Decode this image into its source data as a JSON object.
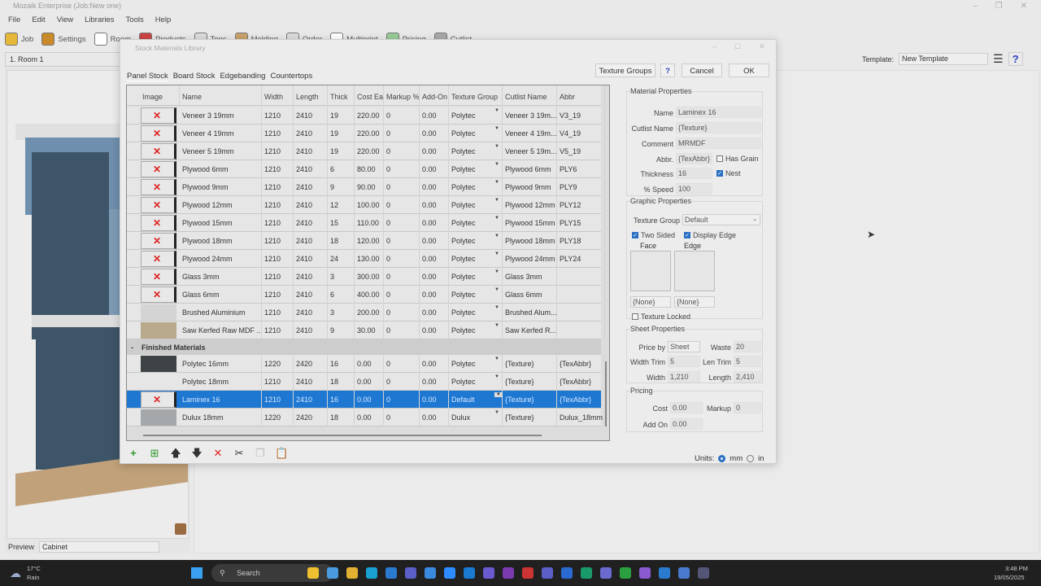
{
  "app": {
    "title": "Mozaik Enterprise (Job:New one)",
    "menu": [
      "File",
      "Edit",
      "View",
      "Libraries",
      "Tools",
      "Help"
    ],
    "toolbar": [
      "Job",
      "Settings",
      "Room",
      "Products",
      "Tops",
      "Molding",
      "Order",
      "Multiprint",
      "Pricing",
      "Cutlist"
    ],
    "room": "1. Room 1",
    "preview_label": "Preview",
    "preview_value": "Cabinet",
    "template_label": "Template:",
    "template_value": "New Template"
  },
  "dialog": {
    "title": "Stock Materials Library",
    "texture_groups": "Texture Groups",
    "cancel": "Cancel",
    "ok": "OK",
    "tabs": [
      "Panel Stock",
      "Board Stock",
      "Edgebanding",
      "Countertops"
    ],
    "columns": [
      "Image",
      "Name",
      "Width",
      "Length",
      "Thick",
      "Cost Each",
      "Markup %",
      "Add-On",
      "Texture Group",
      "Cutlist Name",
      "Abbr"
    ],
    "rows": [
      {
        "image": "missing",
        "name": "Veneer 3 19mm",
        "width": "1210",
        "length": "2410",
        "thick": "19",
        "cost": "220.00",
        "markup": "0",
        "addon": "0.00",
        "group": "Polytec",
        "cutlist": "Veneer 3 19m...",
        "abbr": "V3_19"
      },
      {
        "image": "missing",
        "name": "Veneer 4 19mm",
        "width": "1210",
        "length": "2410",
        "thick": "19",
        "cost": "220.00",
        "markup": "0",
        "addon": "0.00",
        "group": "Polytec",
        "cutlist": "Veneer 4 19m...",
        "abbr": "V4_19"
      },
      {
        "image": "missing",
        "name": "Veneer 5 19mm",
        "width": "1210",
        "length": "2410",
        "thick": "19",
        "cost": "220.00",
        "markup": "0",
        "addon": "0.00",
        "group": "Polytec",
        "cutlist": "Veneer 5 19m...",
        "abbr": "V5_19"
      },
      {
        "image": "missing",
        "name": "Plywood 6mm",
        "width": "1210",
        "length": "2410",
        "thick": "6",
        "cost": "80.00",
        "markup": "0",
        "addon": "0.00",
        "group": "Polytec",
        "cutlist": "Plywood 6mm",
        "abbr": "PLY6"
      },
      {
        "image": "missing",
        "name": "Plywood 9mm",
        "width": "1210",
        "length": "2410",
        "thick": "9",
        "cost": "90.00",
        "markup": "0",
        "addon": "0.00",
        "group": "Polytec",
        "cutlist": "Plywood 9mm",
        "abbr": "PLY9"
      },
      {
        "image": "missing",
        "name": "Plywood 12mm",
        "width": "1210",
        "length": "2410",
        "thick": "12",
        "cost": "100.00",
        "markup": "0",
        "addon": "0.00",
        "group": "Polytec",
        "cutlist": "Plywood 12mm",
        "abbr": "PLY12"
      },
      {
        "image": "missing",
        "name": "Plywood 15mm",
        "width": "1210",
        "length": "2410",
        "thick": "15",
        "cost": "110.00",
        "markup": "0",
        "addon": "0.00",
        "group": "Polytec",
        "cutlist": "Plywood 15mm",
        "abbr": "PLY15"
      },
      {
        "image": "missing",
        "name": "Plywood 18mm",
        "width": "1210",
        "length": "2410",
        "thick": "18",
        "cost": "120.00",
        "markup": "0",
        "addon": "0.00",
        "group": "Polytec",
        "cutlist": "Plywood 18mm",
        "abbr": "PLY18"
      },
      {
        "image": "missing",
        "name": "Plywood 24mm",
        "width": "1210",
        "length": "2410",
        "thick": "24",
        "cost": "130.00",
        "markup": "0",
        "addon": "0.00",
        "group": "Polytec",
        "cutlist": "Plywood 24mm",
        "abbr": "PLY24"
      },
      {
        "image": "missing",
        "name": "Glass 3mm",
        "width": "1210",
        "length": "2410",
        "thick": "3",
        "cost": "300.00",
        "markup": "0",
        "addon": "0.00",
        "group": "Polytec",
        "cutlist": "Glass 3mm",
        "abbr": ""
      },
      {
        "image": "missing",
        "name": "Glass 6mm",
        "width": "1210",
        "length": "2410",
        "thick": "6",
        "cost": "400.00",
        "markup": "0",
        "addon": "0.00",
        "group": "Polytec",
        "cutlist": "Glass 6mm",
        "abbr": ""
      },
      {
        "image": "#d4d4d4",
        "name": "Brushed Aluminium",
        "width": "1210",
        "length": "2410",
        "thick": "3",
        "cost": "200.00",
        "markup": "0",
        "addon": "0.00",
        "group": "Polytec",
        "cutlist": "Brushed Alum...",
        "abbr": ""
      },
      {
        "image": "#b8a88c",
        "name": "Saw Kerfed Raw MDF ...",
        "width": "1210",
        "length": "2410",
        "thick": "9",
        "cost": "30.00",
        "markup": "0",
        "addon": "0.00",
        "group": "Polytec",
        "cutlist": "Saw Kerfed R...",
        "abbr": ""
      }
    ],
    "group_label": "Finished Materials",
    "group_toggle": "-",
    "group_rows": [
      {
        "image": "#3d4244",
        "name": "Polytec 16mm",
        "width": "1220",
        "length": "2420",
        "thick": "16",
        "cost": "0.00",
        "markup": "0",
        "addon": "0.00",
        "group": "Polytec",
        "cutlist": "{Texture}",
        "abbr": "{TexAbbr}"
      },
      {
        "image": "#e6e6e6",
        "name": "Polytec 18mm",
        "width": "1210",
        "length": "2410",
        "thick": "18",
        "cost": "0.00",
        "markup": "0",
        "addon": "0.00",
        "group": "Polytec",
        "cutlist": "{Texture}",
        "abbr": "{TexAbbr}"
      },
      {
        "image": "missing",
        "name": "Laminex 16",
        "width": "1210",
        "length": "2410",
        "thick": "16",
        "cost": "0.00",
        "markup": "0",
        "addon": "0.00",
        "group": "Default",
        "cutlist": "{Texture}",
        "abbr": "{TexAbbr}",
        "selected": true
      },
      {
        "image": "#a5a8aa",
        "name": "Dulux 18mm",
        "width": "1220",
        "length": "2420",
        "thick": "18",
        "cost": "0.00",
        "markup": "0",
        "addon": "0.00",
        "group": "Dulux",
        "cutlist": "{Texture}",
        "abbr": "Dulux_18mm"
      }
    ],
    "material": {
      "legend": "Material Properties",
      "name_label": "Name",
      "name": "Laminex 16",
      "cutlist_label": "Cutlist Name",
      "cutlist": "{Texture}",
      "comment_label": "Comment",
      "comment": "MRMDF",
      "abbr_label": "Abbr.",
      "abbr": "{TexAbbr}",
      "has_grain_label": "Has Grain",
      "has_grain": false,
      "thickness_label": "Thickness",
      "thickness": "16",
      "nest_label": "Nest",
      "nest": true,
      "speed_label": "% Speed",
      "speed": "100"
    },
    "graphic": {
      "legend": "Graphic Properties",
      "texture_group_label": "Texture Group",
      "texture_group": "Default",
      "two_sided_label": "Two Sided",
      "two_sided": true,
      "display_edge_label": "Display Edge",
      "display_edge": true,
      "face_label": "Face",
      "edge_label": "Edge",
      "face_value": "{None}",
      "edge_value": "{None}",
      "texture_locked_label": "Texture Locked",
      "texture_locked": false
    },
    "sheet": {
      "legend": "Sheet Properties",
      "price_by_label": "Price by",
      "price_by": "Sheet",
      "waste_label": "Waste",
      "waste": "20",
      "width_trim_label": "Width Trim",
      "width_trim": "5",
      "len_trim_label": "Len Trim",
      "len_trim": "5",
      "width_label": "Width",
      "width": "1,210",
      "length_label": "Length",
      "length": "2,410"
    },
    "pricing": {
      "legend": "Pricing",
      "cost_label": "Cost",
      "cost": "0.00",
      "markup_label": "Markup",
      "markup": "0",
      "addon_label": "Add On",
      "addon": "0.00"
    },
    "units_label": "Units:",
    "units_mm": "mm",
    "units_in": "in",
    "units_selected": "mm"
  },
  "taskbar": {
    "temp": "17°C",
    "weather": "Rain",
    "search": "Search",
    "time": "3:48 PM",
    "date": "19/05/2025"
  },
  "colors": {
    "selection": "#1e78d2",
    "missing_image": "#dd2222"
  }
}
